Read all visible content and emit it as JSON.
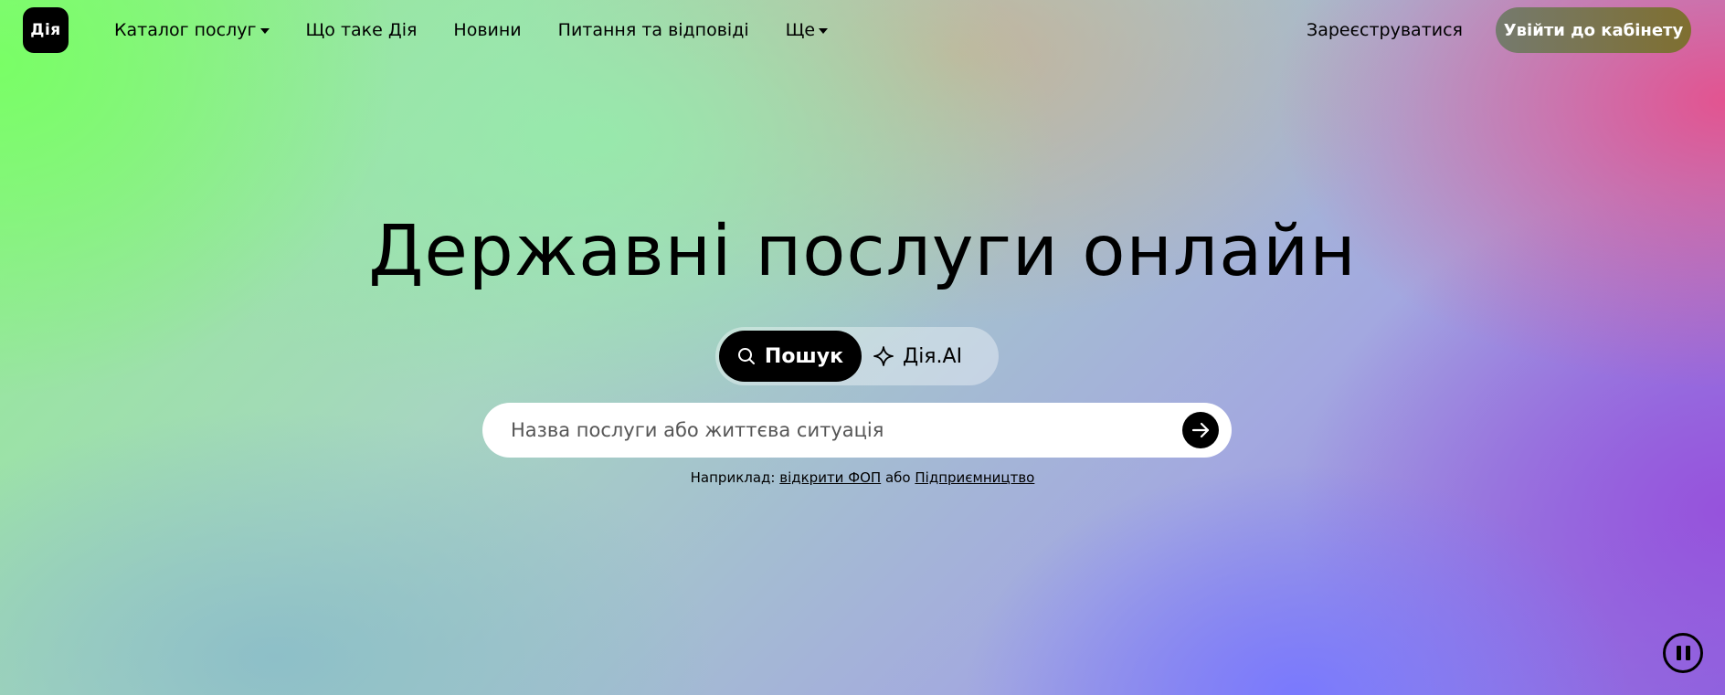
{
  "header": {
    "logo_text": "Дія",
    "nav": [
      {
        "label": "Каталог послуг",
        "has_dropdown": true
      },
      {
        "label": "Що таке Дія",
        "has_dropdown": false
      },
      {
        "label": "Новини",
        "has_dropdown": false
      },
      {
        "label": "Питання та відповіді",
        "has_dropdown": false
      },
      {
        "label": "Ще",
        "has_dropdown": true
      }
    ],
    "register_label": "Зареєструватися",
    "login_label": "Увійти до кабінету"
  },
  "hero": {
    "title": "Державні послуги онлайн",
    "tabs": {
      "search_label": "Пошук",
      "search_icon": "search-icon",
      "ai_label": "Дія.AI",
      "ai_icon": "sparkle-icon",
      "active": "search"
    },
    "search": {
      "placeholder": "Назва послуги або життєва ситуація",
      "value": "",
      "submit_icon": "arrow-right-icon"
    },
    "example": {
      "prefix": "Наприклад:",
      "link1": "відкрити ФОП",
      "middle": "або",
      "link2": "Підприємництво"
    }
  },
  "controls": {
    "pause_icon": "pause-icon"
  },
  "colors": {
    "login_button_start": "#757a6e",
    "login_button_end": "#7f6f30",
    "active_tab": "#000000",
    "search_box": "#ffffff"
  }
}
